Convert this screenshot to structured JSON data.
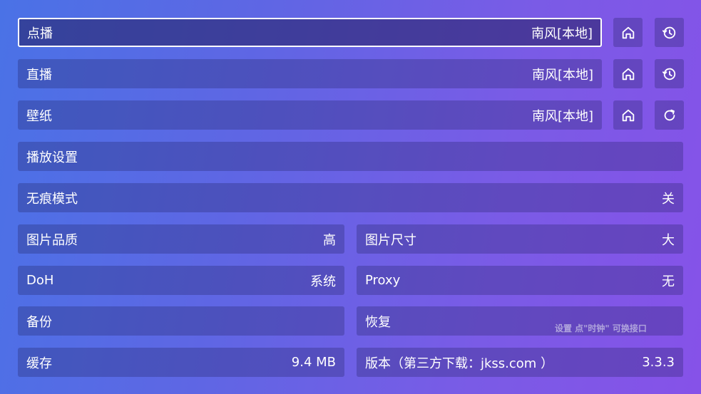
{
  "rows": {
    "vod": {
      "label": "点播",
      "value": "南风[本地]"
    },
    "live": {
      "label": "直播",
      "value": "南风[本地]"
    },
    "wallpaper": {
      "label": "壁纸",
      "value": "南风[本地]"
    },
    "playback": {
      "label": "播放设置"
    },
    "incognito": {
      "label": "无痕模式",
      "value": "关"
    },
    "image_quality": {
      "label": "图片品质",
      "value": "高"
    },
    "image_size": {
      "label": "图片尺寸",
      "value": "大"
    },
    "doh": {
      "label": "DoH",
      "value": "系统"
    },
    "proxy": {
      "label": "Proxy",
      "value": "无"
    },
    "backup": {
      "label": "备份"
    },
    "restore": {
      "label": "恢复"
    },
    "cache": {
      "label": "缓存",
      "value": "9.4 MB"
    },
    "version": {
      "label": "版本（第三方下载：jkss.com ）",
      "value": "3.3.3"
    }
  },
  "hint": "设置  点\"时钟\" 可换接口",
  "icons": {
    "home": "home-icon",
    "history": "history-icon",
    "refresh": "refresh-icon"
  }
}
